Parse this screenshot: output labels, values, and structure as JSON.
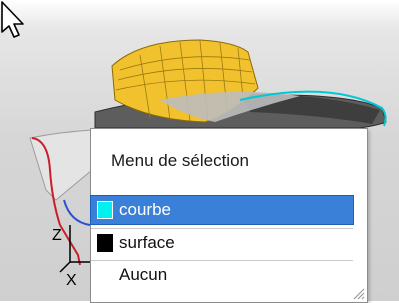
{
  "popup": {
    "title": "Menu de sélection",
    "options": [
      {
        "label": "courbe",
        "swatch_color": "#00f0f0",
        "selected": true
      },
      {
        "label": "surface",
        "swatch_color": "#000000",
        "selected": false
      },
      {
        "label": "Aucun",
        "swatch_color": null,
        "selected": false
      }
    ]
  },
  "axes": {
    "z_label": "Z",
    "x_label": "X"
  },
  "colors": {
    "selection_highlight": "#3a80d8",
    "selected_surface": "#f2c12e",
    "curve_cyan": "#00c8d4",
    "curve_red": "#c8202a"
  },
  "icons": [
    "mouse-cursor-icon",
    "resize-grip-icon"
  ]
}
